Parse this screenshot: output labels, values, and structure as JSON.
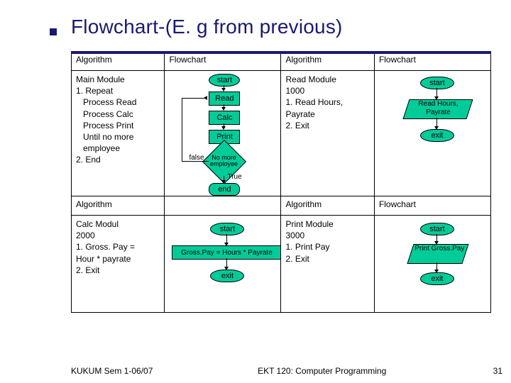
{
  "title": "Flowchart-(E. g from previous)",
  "headers": {
    "alg": "Algorithm",
    "fc": "Flowchart"
  },
  "main": {
    "title": "Main Module",
    "l1": "1. Repeat",
    "l2": "Process Read",
    "l3": "Process Calc",
    "l4": "Process Print",
    "l5": "Until no more",
    "l6": "employee",
    "l7": "2. End"
  },
  "mainfc": {
    "start": "start",
    "read": "Read",
    "calc": "Calc",
    "print": "Print",
    "cond": "No more employee",
    "t": "True",
    "f": "false",
    "end": "end"
  },
  "read": {
    "title": "Read Module",
    "num": "1000",
    "l1": "1. Read Hours,",
    "l2": "Payrate",
    "l3": "2. Exit"
  },
  "readfc": {
    "start": "start",
    "box": "Read Hours, Payrate",
    "exit": "exit"
  },
  "calc": {
    "title": "Calc Modul",
    "num": "2000",
    "l1": "1. Gross. Pay =",
    "l2": "Hour * payrate",
    "l3": "2. Exit"
  },
  "calcfc": {
    "start": "start",
    "box": "Gross.Pay = Hours * Payrate",
    "exit": "exit"
  },
  "print": {
    "title": "Print Module",
    "num": "3000",
    "l1": "1. Print Pay",
    "l2": "2. Exit"
  },
  "printfc": {
    "start": "start",
    "box": "Print Gross.Pay",
    "exit": "exit"
  },
  "footer": {
    "left": "KUKUM Sem 1-06/07",
    "center": "EKT 120: Computer Programming",
    "page": "31"
  }
}
